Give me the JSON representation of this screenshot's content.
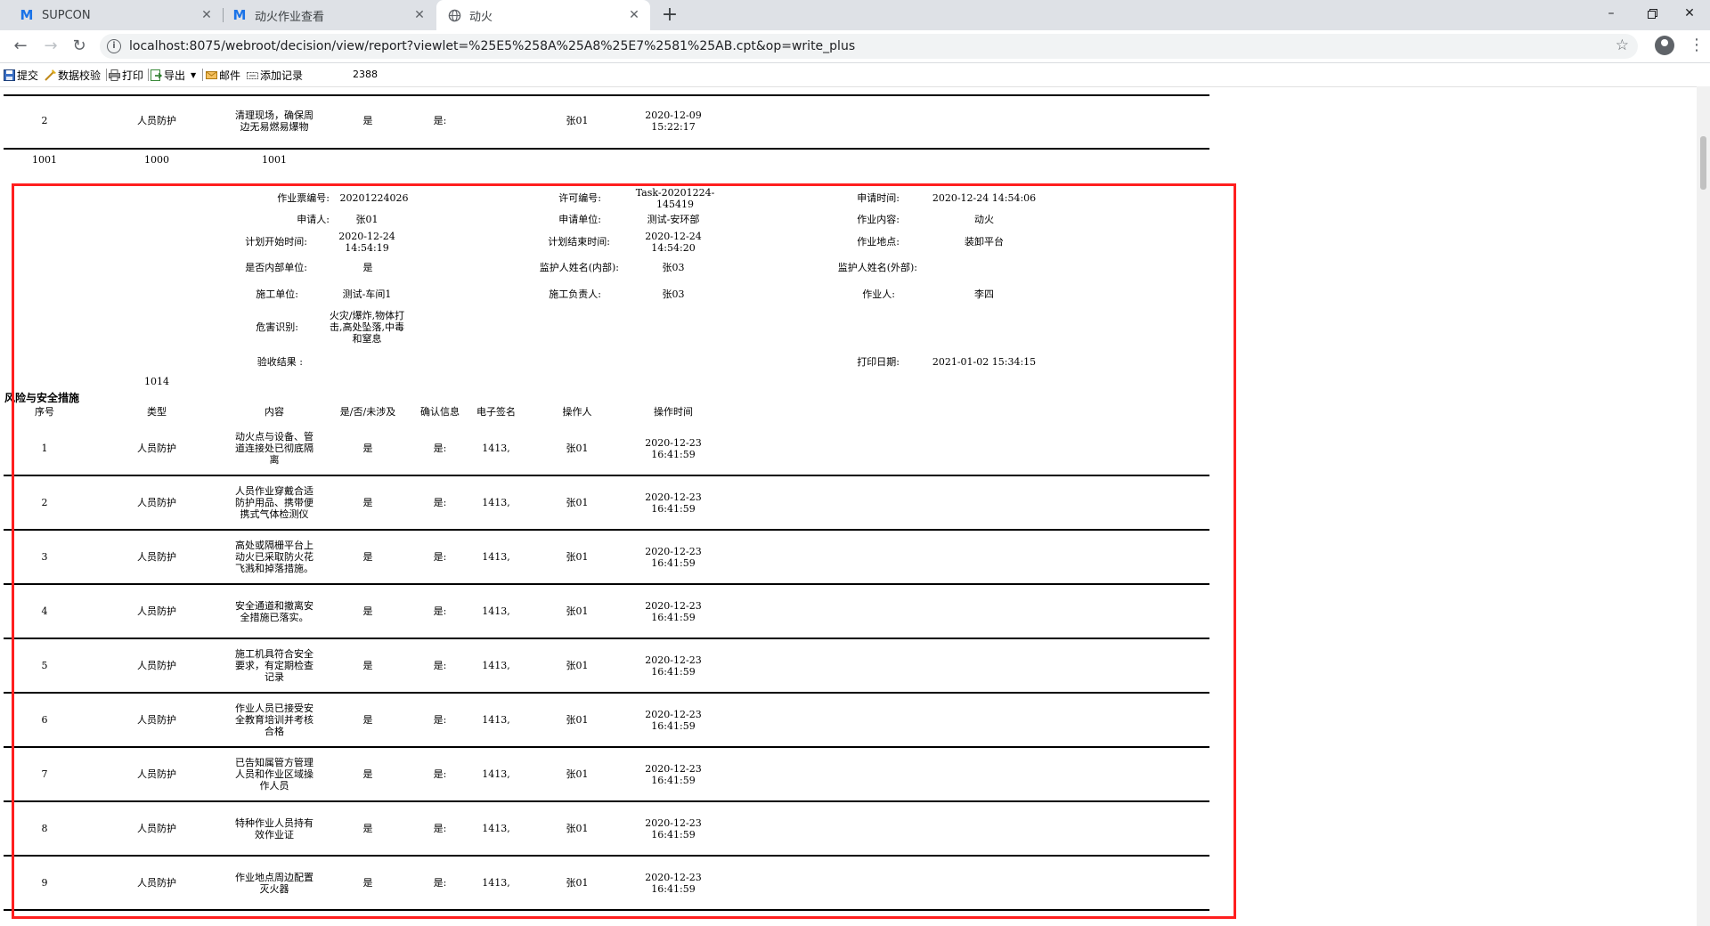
{
  "browser": {
    "tabs": [
      {
        "label": "SUPCON",
        "icon": "supcon-m-icon"
      },
      {
        "label": "动火作业查看",
        "icon": "supcon-m-icon"
      },
      {
        "label": "动火",
        "icon": "globe-icon"
      }
    ],
    "url": "localhost:8075/webroot/decision/view/report?viewlet=%25E5%258A%25A8%25E7%2581%25AB.cpt&op=write_plus"
  },
  "report_toolbar": {
    "submit": "提交",
    "validate": "数据校验",
    "print": "打印",
    "export": "导出",
    "mail": "邮件",
    "add_record": "添加记录",
    "page_count": "2388"
  },
  "prev_section": {
    "row": {
      "no": "2",
      "type": "人员防护",
      "content": [
        "清理现场，确保周",
        "边无易燃易爆物"
      ],
      "yes": "是",
      "confirm": "是:",
      "operator": "张01",
      "date": "2020-12-09",
      "time": "15:22:17"
    },
    "footer": [
      "1001",
      "1000",
      "1001"
    ]
  },
  "ticket": {
    "labels": {
      "ticket_no": "作业票编号:",
      "permit_no": "许可编号:",
      "apply_time": "申请时间:",
      "applicant": "申请人:",
      "apply_unit": "申请单位:",
      "work_content": "作业内容:",
      "plan_start": "计划开始时间:",
      "plan_end": "计划结束时间:",
      "work_place": "作业地点:",
      "internal_unit": "是否内部单位:",
      "guardian_internal": "监护人姓名(内部):",
      "guardian_external": "监护人姓名(外部):",
      "construction_unit": "施工单位:",
      "construction_leader": "施工负责人:",
      "worker": "作业人:",
      "hazard": "危害识别:",
      "acceptance": "验收结果 :",
      "print_date": "打印日期:"
    },
    "values": {
      "ticket_no": "20201224026",
      "permit_no": [
        "Task-20201224-",
        "145419"
      ],
      "apply_time": "2020-12-24 14:54:06",
      "applicant": "张01",
      "apply_unit": "测试-安环部",
      "work_content": "动火",
      "plan_start": [
        "2020-12-24",
        "14:54:19"
      ],
      "plan_end": [
        "2020-12-24",
        "14:54:20"
      ],
      "work_place": "装卸平台",
      "internal_unit": "是",
      "guardian_internal": "张03",
      "construction_unit": "测试-车间1",
      "construction_leader": "张03",
      "worker": "李四",
      "hazard": [
        "火灾/爆炸,物体打",
        "击,高处坠落,中毒",
        "和窒息"
      ],
      "print_date": "2021-01-02 15:34:15"
    },
    "code": "1014"
  },
  "measures": {
    "section_title": "风险与安全措施",
    "headers": [
      "序号",
      "类型",
      "内容",
      "是/否/未涉及",
      "确认信息",
      "电子签名",
      "操作人",
      "操作时间"
    ],
    "rows": [
      {
        "no": "1",
        "type": "人员防护",
        "content": [
          "动火点与设备、管",
          "道连接处已彻底隔",
          "离"
        ],
        "yes": "是",
        "confirm": "是:",
        "sign": "1413,",
        "operator": "张01",
        "date": "2020-12-23",
        "time": "16:41:59"
      },
      {
        "no": "2",
        "type": "人员防护",
        "content": [
          "人员作业穿戴合适",
          "防护用品、携带便",
          "携式气体检测仪"
        ],
        "yes": "是",
        "confirm": "是:",
        "sign": "1413,",
        "operator": "张01",
        "date": "2020-12-23",
        "time": "16:41:59"
      },
      {
        "no": "3",
        "type": "人员防护",
        "content": [
          "高处或隔栅平台上",
          "动火已采取防火花",
          "飞溅和掉落措施。"
        ],
        "yes": "是",
        "confirm": "是:",
        "sign": "1413,",
        "operator": "张01",
        "date": "2020-12-23",
        "time": "16:41:59"
      },
      {
        "no": "4",
        "type": "人员防护",
        "content": [
          "安全通道和撤离安",
          "全措施已落实。"
        ],
        "yes": "是",
        "confirm": "是:",
        "sign": "1413,",
        "operator": "张01",
        "date": "2020-12-23",
        "time": "16:41:59"
      },
      {
        "no": "5",
        "type": "人员防护",
        "content": [
          "施工机具符合安全",
          "要求，有定期检查",
          "记录"
        ],
        "yes": "是",
        "confirm": "是:",
        "sign": "1413,",
        "operator": "张01",
        "date": "2020-12-23",
        "time": "16:41:59"
      },
      {
        "no": "6",
        "type": "人员防护",
        "content": [
          "作业人员已接受安",
          "全教育培训并考核",
          "合格"
        ],
        "yes": "是",
        "confirm": "是:",
        "sign": "1413,",
        "operator": "张01",
        "date": "2020-12-23",
        "time": "16:41:59"
      },
      {
        "no": "7",
        "type": "人员防护",
        "content": [
          "已告知属管方管理",
          "人员和作业区域操",
          "作人员"
        ],
        "yes": "是",
        "confirm": "是:",
        "sign": "1413,",
        "operator": "张01",
        "date": "2020-12-23",
        "time": "16:41:59"
      },
      {
        "no": "8",
        "type": "人员防护",
        "content": [
          "特种作业人员持有",
          "效作业证"
        ],
        "yes": "是",
        "confirm": "是:",
        "sign": "1413,",
        "operator": "张01",
        "date": "2020-12-23",
        "time": "16:41:59"
      },
      {
        "no": "9",
        "type": "人员防护",
        "content": [
          "作业地点周边配置",
          "灭火器"
        ],
        "yes": "是",
        "confirm": "是:",
        "sign": "1413,",
        "operator": "张01",
        "date": "2020-12-23",
        "time": "16:41:59"
      }
    ]
  },
  "colors": {
    "highlight": "#ff1f1f",
    "tabstrip": "#dee1e6",
    "accent": "#1a73e8"
  }
}
